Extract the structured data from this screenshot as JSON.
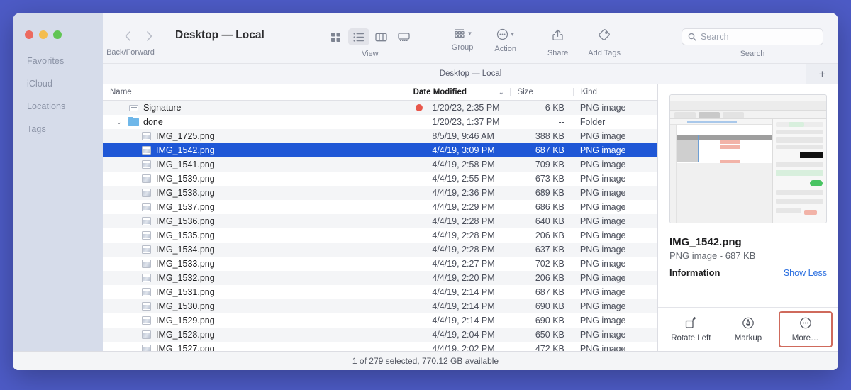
{
  "desktop": {
    "background": "#4d5bc6"
  },
  "window": {
    "title": "Desktop — Local",
    "traffic_lights": [
      "close",
      "minimize",
      "zoom"
    ]
  },
  "toolbar": {
    "nav": {
      "back": "‹",
      "forward": "›",
      "label": "Back/Forward"
    },
    "view": {
      "label": "View",
      "modes": [
        "icon-view",
        "list-view",
        "column-view",
        "gallery-view"
      ],
      "active": "list-view"
    },
    "group": {
      "label": "Group",
      "icon": "group-icon"
    },
    "action": {
      "label": "Action",
      "icon": "action-icon"
    },
    "share": {
      "label": "Share",
      "icon": "share-icon"
    },
    "add_tags": {
      "label": "Add Tags",
      "icon": "tag-icon"
    },
    "search": {
      "label": "Search",
      "placeholder": "Search",
      "value": "",
      "icon": "search-icon"
    }
  },
  "pathbar": {
    "path": "Desktop — Local",
    "new_tab": "+"
  },
  "columns": [
    {
      "key": "name",
      "label": "Name",
      "sorted": false
    },
    {
      "key": "date",
      "label": "Date Modified",
      "sorted": true,
      "sort_indicator": "⌄"
    },
    {
      "key": "size",
      "label": "Size",
      "sorted": false
    },
    {
      "key": "kind",
      "label": "Kind",
      "sorted": false
    }
  ],
  "sidebar": {
    "sections": [
      {
        "label": "Favorites"
      },
      {
        "label": "iCloud"
      },
      {
        "label": "Locations"
      },
      {
        "label": "Tags"
      }
    ]
  },
  "files": [
    {
      "name": "Signature",
      "icon": "signature-icon",
      "tag": "red",
      "date": "1/20/23, 2:35 PM",
      "size": "6 KB",
      "kind": "PNG image",
      "depth": 0,
      "selected": false,
      "disclosure": ""
    },
    {
      "name": "done",
      "icon": "folder-icon",
      "tag": "",
      "date": "1/20/23, 1:37 PM",
      "size": "--",
      "kind": "Folder",
      "depth": 0,
      "selected": false,
      "disclosure": "⌄"
    },
    {
      "name": "IMG_1725.png",
      "icon": "image-icon",
      "tag": "",
      "date": "8/5/19, 9:46 AM",
      "size": "388 KB",
      "kind": "PNG image",
      "depth": 1,
      "selected": false,
      "disclosure": ""
    },
    {
      "name": "IMG_1542.png",
      "icon": "image-icon",
      "tag": "",
      "date": "4/4/19, 3:09 PM",
      "size": "687 KB",
      "kind": "PNG image",
      "depth": 1,
      "selected": true,
      "disclosure": ""
    },
    {
      "name": "IMG_1541.png",
      "icon": "image-icon",
      "tag": "",
      "date": "4/4/19, 2:58 PM",
      "size": "709 KB",
      "kind": "PNG image",
      "depth": 1,
      "selected": false,
      "disclosure": ""
    },
    {
      "name": "IMG_1539.png",
      "icon": "image-icon",
      "tag": "",
      "date": "4/4/19, 2:55 PM",
      "size": "673 KB",
      "kind": "PNG image",
      "depth": 1,
      "selected": false,
      "disclosure": ""
    },
    {
      "name": "IMG_1538.png",
      "icon": "image-icon",
      "tag": "",
      "date": "4/4/19, 2:36 PM",
      "size": "689 KB",
      "kind": "PNG image",
      "depth": 1,
      "selected": false,
      "disclosure": ""
    },
    {
      "name": "IMG_1537.png",
      "icon": "image-icon",
      "tag": "",
      "date": "4/4/19, 2:29 PM",
      "size": "686 KB",
      "kind": "PNG image",
      "depth": 1,
      "selected": false,
      "disclosure": ""
    },
    {
      "name": "IMG_1536.png",
      "icon": "image-icon",
      "tag": "",
      "date": "4/4/19, 2:28 PM",
      "size": "640 KB",
      "kind": "PNG image",
      "depth": 1,
      "selected": false,
      "disclosure": ""
    },
    {
      "name": "IMG_1535.png",
      "icon": "image-icon",
      "tag": "",
      "date": "4/4/19, 2:28 PM",
      "size": "206 KB",
      "kind": "PNG image",
      "depth": 1,
      "selected": false,
      "disclosure": ""
    },
    {
      "name": "IMG_1534.png",
      "icon": "image-icon",
      "tag": "",
      "date": "4/4/19, 2:28 PM",
      "size": "637 KB",
      "kind": "PNG image",
      "depth": 1,
      "selected": false,
      "disclosure": ""
    },
    {
      "name": "IMG_1533.png",
      "icon": "image-icon",
      "tag": "",
      "date": "4/4/19, 2:27 PM",
      "size": "702 KB",
      "kind": "PNG image",
      "depth": 1,
      "selected": false,
      "disclosure": ""
    },
    {
      "name": "IMG_1532.png",
      "icon": "image-icon",
      "tag": "",
      "date": "4/4/19, 2:20 PM",
      "size": "206 KB",
      "kind": "PNG image",
      "depth": 1,
      "selected": false,
      "disclosure": ""
    },
    {
      "name": "IMG_1531.png",
      "icon": "image-icon",
      "tag": "",
      "date": "4/4/19, 2:14 PM",
      "size": "687 KB",
      "kind": "PNG image",
      "depth": 1,
      "selected": false,
      "disclosure": ""
    },
    {
      "name": "IMG_1530.png",
      "icon": "image-icon",
      "tag": "",
      "date": "4/4/19, 2:14 PM",
      "size": "690 KB",
      "kind": "PNG image",
      "depth": 1,
      "selected": false,
      "disclosure": ""
    },
    {
      "name": "IMG_1529.png",
      "icon": "image-icon",
      "tag": "",
      "date": "4/4/19, 2:14 PM",
      "size": "690 KB",
      "kind": "PNG image",
      "depth": 1,
      "selected": false,
      "disclosure": ""
    },
    {
      "name": "IMG_1528.png",
      "icon": "image-icon",
      "tag": "",
      "date": "4/4/19, 2:04 PM",
      "size": "650 KB",
      "kind": "PNG image",
      "depth": 1,
      "selected": false,
      "disclosure": ""
    },
    {
      "name": "IMG_1527.png",
      "icon": "image-icon",
      "tag": "",
      "date": "4/4/19, 2:02 PM",
      "size": "472 KB",
      "kind": "PNG image",
      "depth": 1,
      "selected": false,
      "disclosure": ""
    }
  ],
  "preview": {
    "thumbnail_alt": "spreadsheet-screenshot-thumbnail",
    "file_name": "IMG_1542.png",
    "file_meta": "PNG image - 687 KB",
    "information_label": "Information",
    "show_less_label": "Show Less",
    "actions": [
      {
        "label": "Rotate Left",
        "icon": "rotate-left-icon",
        "highlighted": false
      },
      {
        "label": "Markup",
        "icon": "markup-icon",
        "highlighted": false
      },
      {
        "label": "More…",
        "icon": "more-icon",
        "highlighted": true
      }
    ],
    "highlight_color": "#cf6a5c"
  },
  "statusbar": {
    "text": "1 of 279 selected, 770.12 GB available"
  },
  "colors": {
    "selection": "#1f57d6",
    "tag_red": "#e8574b",
    "link": "#2b6fe0"
  }
}
